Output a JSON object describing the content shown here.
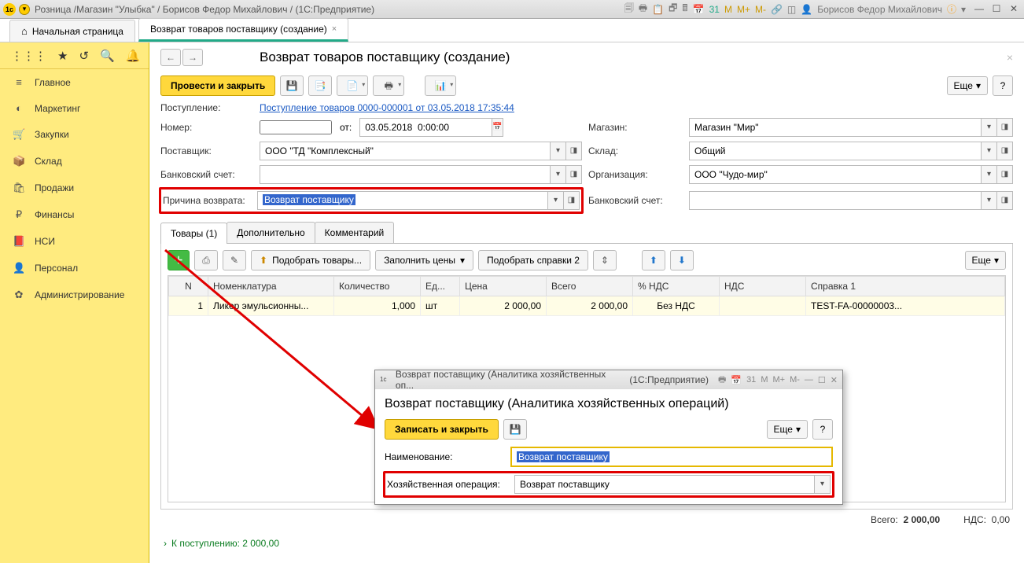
{
  "titlebar": {
    "text": "Розница /Магазин \"Улыбка\" / Борисов Федор Михайлович / (1С:Предприятие)",
    "user": "Борисов Федор Михайлович",
    "m": "M",
    "mplus": "M+",
    "mminus": "M-"
  },
  "tabs": {
    "home": "Начальная страница",
    "doc": "Возврат товаров поставщику (создание)"
  },
  "sidebar": {
    "items": [
      {
        "icon": "≡",
        "label": "Главное"
      },
      {
        "icon": "◐",
        "label": "Маркетинг"
      },
      {
        "icon": "🛒",
        "label": "Закупки"
      },
      {
        "icon": "📦",
        "label": "Склад"
      },
      {
        "icon": "🛍",
        "label": "Продажи"
      },
      {
        "icon": "₽",
        "label": "Финансы"
      },
      {
        "icon": "📕",
        "label": "НСИ"
      },
      {
        "icon": "👤",
        "label": "Персонал"
      },
      {
        "icon": "✿",
        "label": "Администрирование"
      }
    ]
  },
  "page": {
    "title": "Возврат товаров поставщику (создание)",
    "btn_process": "Провести и закрыть",
    "btn_more": "Еще",
    "labels": {
      "receipt": "Поступление:",
      "receipt_link": "Поступление товаров 0000-000001 от 03.05.2018 17:35:44",
      "number": "Номер:",
      "ot": "от:",
      "date": "03.05.2018  0:00:00",
      "shop": "Магазин:",
      "supplier": "Поставщик:",
      "warehouse": "Склад:",
      "bank": "Банковский счет:",
      "org": "Организация:",
      "reason": "Причина возврата:",
      "bank2": "Банковский счет:"
    },
    "values": {
      "shop": "Магазин \"Мир\"",
      "supplier": "ООО \"ТД \"Комплексный\"",
      "warehouse": "Общий",
      "org": "ООО \"Чудо-мир\"",
      "reason": "Возврат поставщику"
    },
    "tabs2": {
      "goods": "Товары (1)",
      "extra": "Дополнительно",
      "comment": "Комментарий"
    },
    "toolbar2": {
      "pick": "Подобрать товары...",
      "fill_prices": "Заполнить цены",
      "pick_ref": "Подобрать справки 2"
    },
    "grid": {
      "cols": [
        "N",
        "Номенклатура",
        "Количество",
        "Ед...",
        "Цена",
        "Всего",
        "% НДС",
        "НДС",
        "Справка 1"
      ],
      "row": {
        "n": "1",
        "name": "Ликер эмульсионны...",
        "qty": "1,000",
        "unit": "шт",
        "price": "2 000,00",
        "total": "2 000,00",
        "vatpct": "Без НДС",
        "vat": "",
        "ref": "TEST-FA-00000003..."
      }
    },
    "totals": {
      "total_lbl": "Всего:",
      "total": "2 000,00",
      "vat_lbl": "НДС:",
      "vat": "0,00"
    },
    "footer": "К поступлению: 2 000,00"
  },
  "dialog": {
    "title_a": "Возврат поставщику (Аналитика хозяйственных оп...",
    "title_b": "(1С:Предприятие)",
    "m": "M",
    "mplus": "M+",
    "mminus": "M-",
    "heading": "Возврат поставщику (Аналитика хозяйственных операций)",
    "btn_save": "Записать и закрыть",
    "btn_more": "Еще",
    "lbl_name": "Наименование:",
    "val_name": "Возврат поставщику",
    "lbl_op": "Хозяйственная операция:",
    "val_op": "Возврат поставщику"
  }
}
